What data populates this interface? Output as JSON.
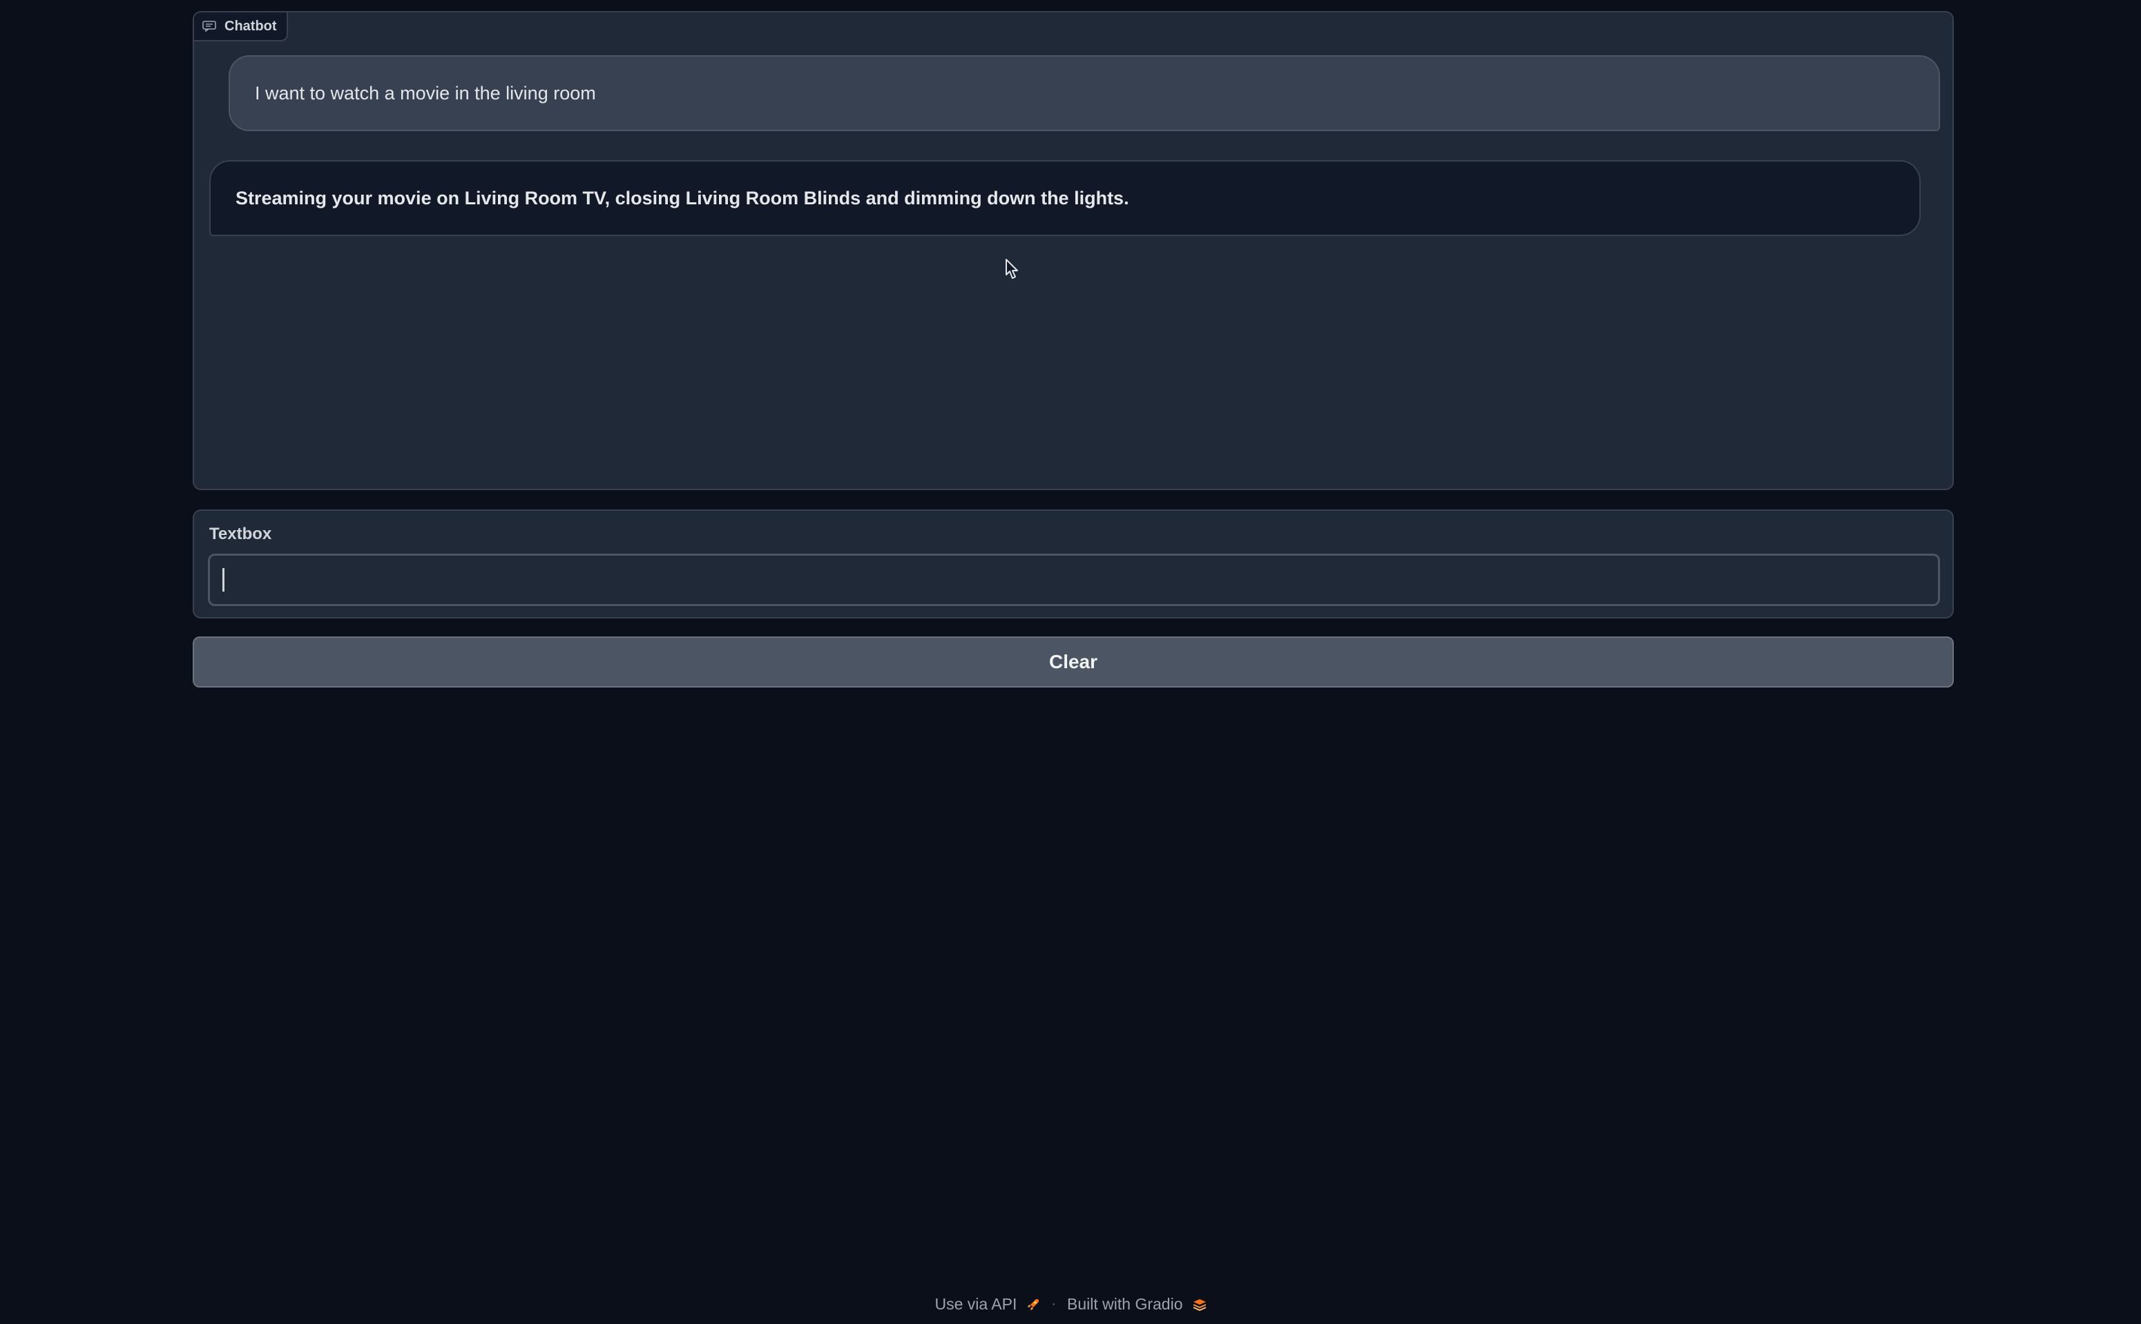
{
  "chatbot": {
    "label": "Chatbot",
    "icon": "chat-bubble-icon",
    "messages": [
      {
        "role": "user",
        "text": "I want to watch a movie in the living room"
      },
      {
        "role": "bot",
        "text": "Streaming your movie on Living Room TV, closing Living Room Blinds and dimming down the lights."
      }
    ]
  },
  "textbox": {
    "label": "Textbox",
    "value": ""
  },
  "clear_button": {
    "label": "Clear"
  },
  "footer": {
    "api_link": "Use via API",
    "api_icon": "rocket-icon",
    "separator": "·",
    "built_with": "Built with Gradio",
    "gradio_icon": "gradio-logo-icon"
  },
  "colors": {
    "background": "#0b0f19",
    "panel": "#1f2937",
    "border": "#374151",
    "user_bubble": "#374151",
    "bot_bubble": "#111827",
    "button": "#4b5563",
    "accent": "#f97316"
  }
}
